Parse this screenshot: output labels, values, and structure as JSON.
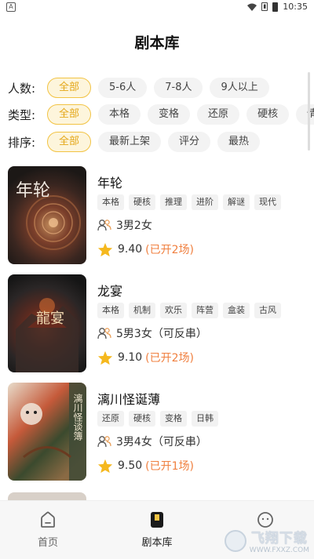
{
  "status_bar": {
    "time": "10:35",
    "left_icon": "A",
    "sim_icon": "sim-icon",
    "wifi_icon": "wifi-icon",
    "battery_icon": "battery-icon"
  },
  "header": {
    "title": "剧本库"
  },
  "filters": {
    "players": {
      "label": "人数:",
      "options": [
        "全部",
        "5-6人",
        "7-8人",
        "9人以上"
      ],
      "selected": "全部"
    },
    "type": {
      "label": "类型:",
      "options": [
        "全部",
        "本格",
        "变格",
        "还原",
        "硬核",
        "情感"
      ],
      "selected": "全部"
    },
    "sort": {
      "label": "排序:",
      "options": [
        "全部",
        "最新上架",
        "评分",
        "最热"
      ],
      "selected": "全部"
    }
  },
  "scripts": [
    {
      "name": "年轮",
      "tags": [
        "本格",
        "硬核",
        "推理",
        "进阶",
        "解谜",
        "现代"
      ],
      "players": "3男2女",
      "score": "9.40",
      "sessions": "(已开2场)",
      "cover_title": "年轮"
    },
    {
      "name": "龙宴",
      "tags": [
        "本格",
        "机制",
        "欢乐",
        "阵营",
        "盒装",
        "古风"
      ],
      "players": "5男3女（可反串）",
      "score": "9.10",
      "sessions": "(已开2场)",
      "cover_title": "龍宴"
    },
    {
      "name": "漓川怪诞薄",
      "tags": [
        "还原",
        "硬核",
        "变格",
        "日韩"
      ],
      "players": "3男4女（可反串）",
      "score": "9.50",
      "sessions": "(已开1场)",
      "cover_title": "漓川怪谈簿"
    }
  ],
  "bottom_nav": [
    {
      "label": "首页",
      "icon": "home-icon",
      "active": false
    },
    {
      "label": "剧本库",
      "icon": "script-library-icon",
      "active": true
    },
    {
      "label": "",
      "icon": "profile-icon",
      "active": false
    }
  ],
  "watermark": {
    "main": "飞翔下载",
    "sub": "WWW.FXXZ.COM"
  },
  "colors": {
    "accent": "#f2c343",
    "accent_text": "#e4a718",
    "session_text": "#f08040",
    "star": "#f5b81e"
  }
}
